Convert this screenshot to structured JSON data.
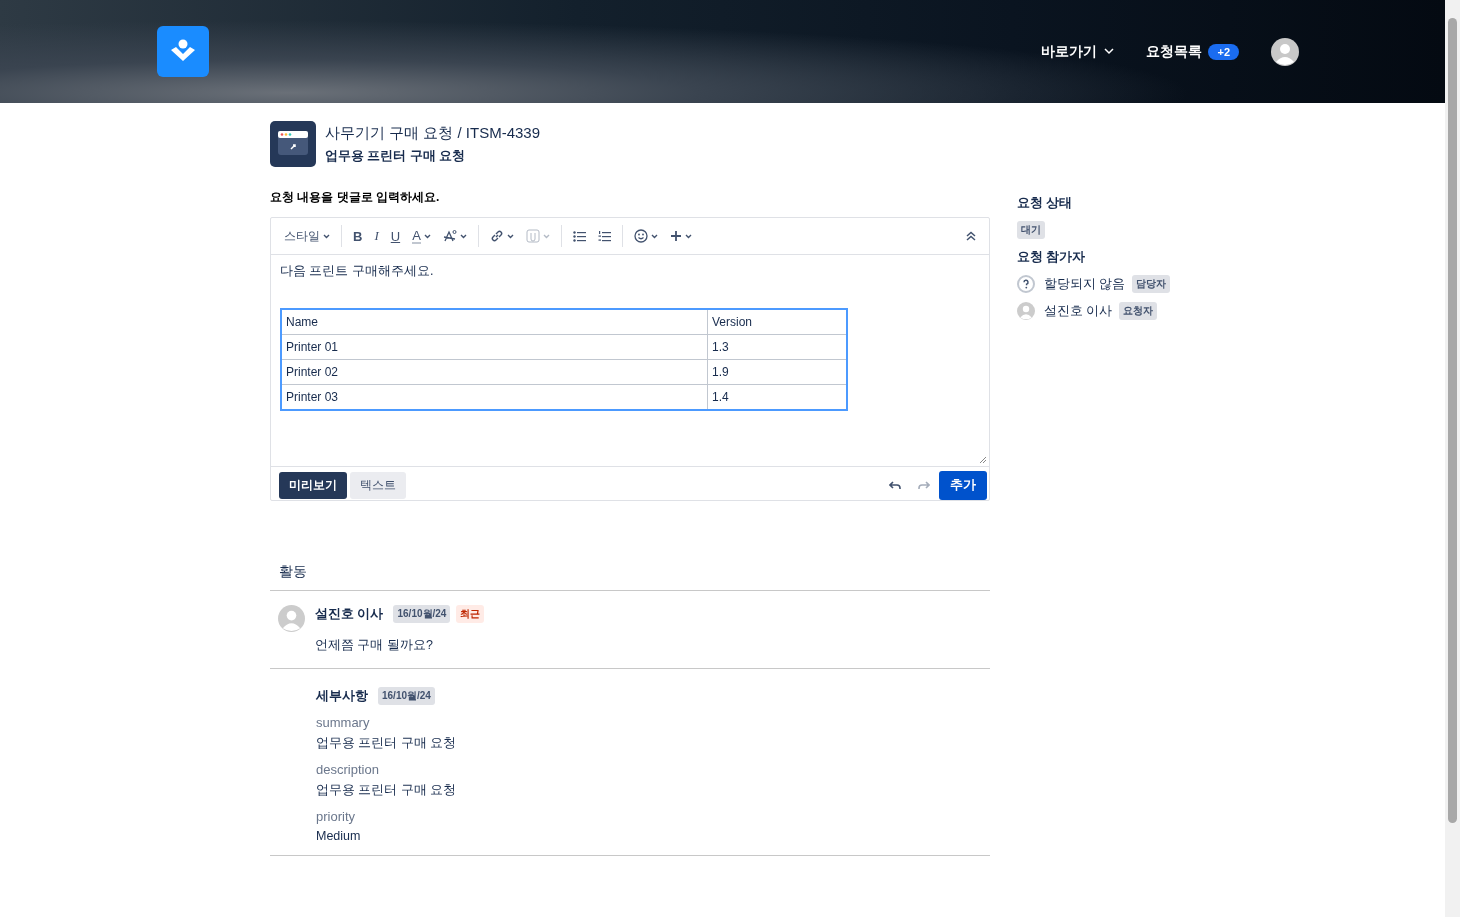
{
  "header": {
    "nav": [
      {
        "label": "바로가기",
        "kind": "dropdown"
      },
      {
        "label": "요청목록",
        "kind": "count",
        "count": "+2"
      }
    ]
  },
  "request": {
    "title": "사무기기 구매 요청 / ITSM-4339",
    "subtitle": "업무용 프린터 구매 요청"
  },
  "editor": {
    "prompt": "요청 내용을 댓글로 입력하세요.",
    "toolbar": [
      [
        {
          "kind": "style",
          "label": "스타일",
          "dropdown": true
        }
      ],
      [
        {
          "kind": "bold",
          "label": "B",
          "dropdown": false
        },
        {
          "kind": "italic",
          "label": "I",
          "dropdown": false
        },
        {
          "kind": "underline",
          "label": "U",
          "dropdown": false
        },
        {
          "kind": "color",
          "label": "A",
          "dropdown": true
        },
        {
          "kind": "clear-format",
          "dropdown": true
        }
      ],
      [
        {
          "kind": "link",
          "dropdown": true
        },
        {
          "kind": "attachment",
          "dropdown": true,
          "disabled": true
        }
      ],
      [
        {
          "kind": "bullets",
          "dropdown": false
        },
        {
          "kind": "numbering",
          "dropdown": false
        }
      ],
      [
        {
          "kind": "emoji",
          "dropdown": true
        },
        {
          "kind": "insert",
          "dropdown": true
        }
      ]
    ],
    "body_text": "다음 프린트 구매해주세요.",
    "table": {
      "columns": [
        "Name",
        "Version"
      ],
      "rows": [
        [
          "Printer 01",
          "1.3"
        ],
        [
          "Printer 02",
          "1.9"
        ],
        [
          "Printer 03",
          "1.4"
        ]
      ]
    },
    "modes": [
      {
        "label": "미리보기",
        "selected": true
      },
      {
        "label": "텍스트",
        "selected": false
      }
    ],
    "undo": {
      "disabled": false
    },
    "redo": {
      "disabled": true
    },
    "submit": "추가"
  },
  "activity": {
    "title": "활동",
    "comment": {
      "author": "설진호 이사",
      "date": "16/10월/24",
      "tag": "최근",
      "text": "언제쯤 구매 될까요?"
    },
    "details": {
      "title": "세부사항",
      "date": "16/10월/24",
      "fields": [
        {
          "label": "summary",
          "value": "업무용 프린터 구매 요청"
        },
        {
          "label": "description",
          "value": "업무용 프린터 구매 요청"
        },
        {
          "label": "priority",
          "value": "Medium"
        }
      ]
    }
  },
  "sidebar": {
    "status_title": "요청 상태",
    "status": "대기",
    "participants_title": "요청 참가자",
    "participants": [
      {
        "name": "할당되지 않음",
        "role": "담당자",
        "kind": "unassigned"
      },
      {
        "name": "설진호 이사",
        "role": "요청자",
        "kind": "user"
      }
    ]
  }
}
